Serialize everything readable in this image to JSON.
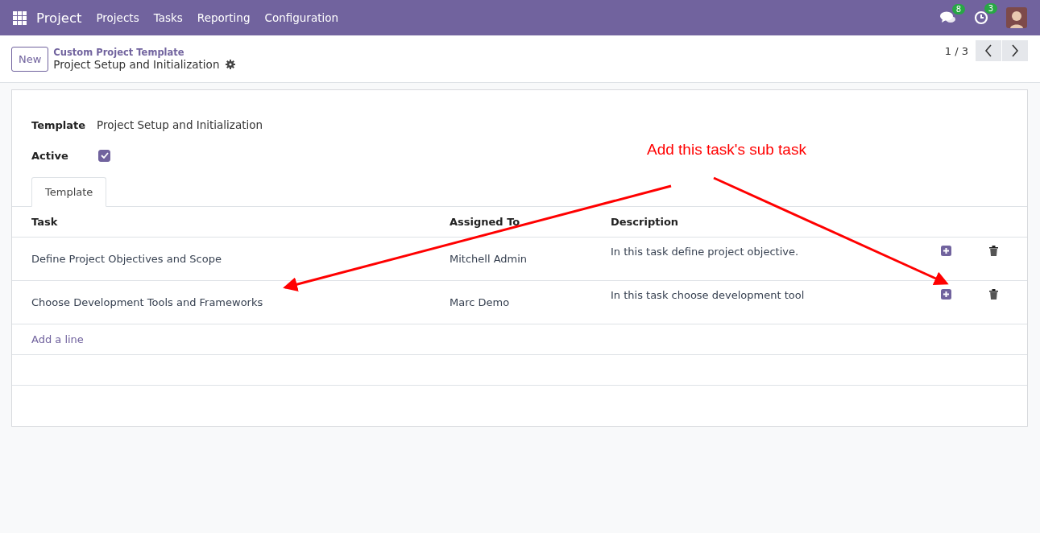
{
  "navbar": {
    "app": "Project",
    "menu": [
      "Projects",
      "Tasks",
      "Reporting",
      "Configuration"
    ],
    "messages_count": "8",
    "activities_count": "3"
  },
  "control_panel": {
    "new_button": "New",
    "breadcrumb": "Custom Project Template",
    "record_title": "Project Setup and Initialization",
    "pager": "1 / 3"
  },
  "form": {
    "fields": [
      {
        "kind": "text",
        "label": "Template",
        "value": "Project Setup and Initialization"
      },
      {
        "kind": "checkbox",
        "label": "Active",
        "checked": true
      }
    ],
    "tabs": [
      {
        "label": "Template",
        "selected": true
      }
    ],
    "table": {
      "columns": [
        "Task",
        "Assigned To",
        "Description"
      ],
      "rows": [
        {
          "task": "Define Project Objectives and Scope",
          "assigned_to": "Mitchell Admin",
          "description": "In this task define project objective."
        },
        {
          "task": "Choose Development Tools and Frameworks",
          "assigned_to": "Marc Demo",
          "description": "In this task choose development tool"
        }
      ],
      "add_line": "Add a line"
    }
  },
  "annotation": {
    "text": "Add this task's sub task"
  }
}
